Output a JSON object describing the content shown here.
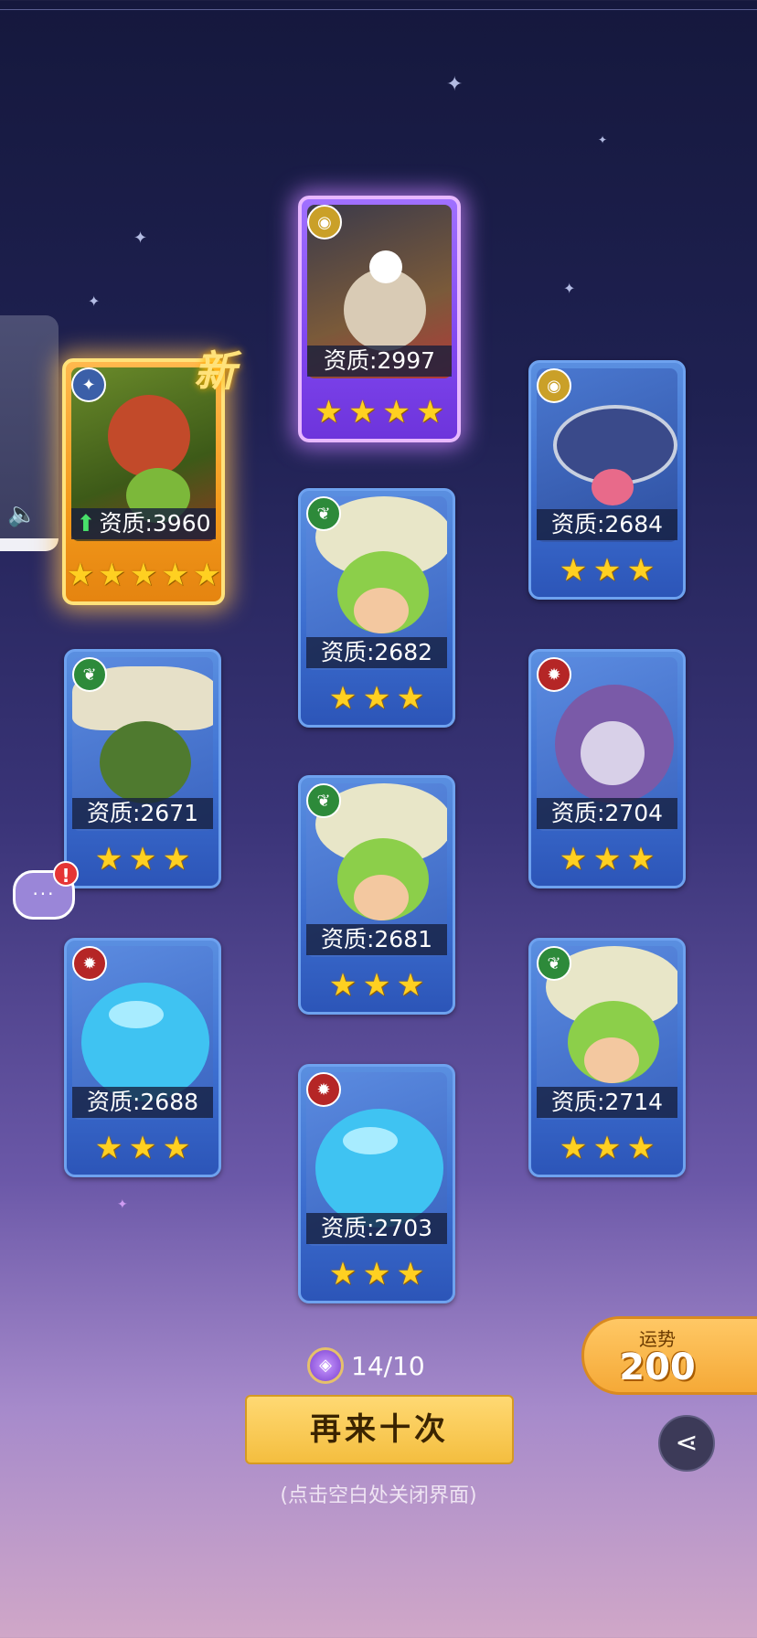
{
  "cards": [
    {
      "quality_label": "资质:3960",
      "stars": 5,
      "element": "water",
      "rarity": "gold",
      "is_new": true,
      "upgrade": true
    },
    {
      "quality_label": "资质:2997",
      "stars": 4,
      "element": "earth",
      "rarity": "purple",
      "is_new": false,
      "upgrade": false
    },
    {
      "quality_label": "资质:2684",
      "stars": 3,
      "element": "earth",
      "rarity": "blue",
      "is_new": false,
      "upgrade": false
    },
    {
      "quality_label": "资质:2682",
      "stars": 3,
      "element": "grass",
      "rarity": "blue",
      "is_new": false,
      "upgrade": false
    },
    {
      "quality_label": "资质:2671",
      "stars": 3,
      "element": "grass",
      "rarity": "blue",
      "is_new": false,
      "upgrade": false
    },
    {
      "quality_label": "资质:2704",
      "stars": 3,
      "element": "fire",
      "rarity": "blue",
      "is_new": false,
      "upgrade": false
    },
    {
      "quality_label": "资质:2681",
      "stars": 3,
      "element": "grass",
      "rarity": "blue",
      "is_new": false,
      "upgrade": false
    },
    {
      "quality_label": "资质:2688",
      "stars": 3,
      "element": "fire",
      "rarity": "blue",
      "is_new": false,
      "upgrade": false
    },
    {
      "quality_label": "资质:2714",
      "stars": 3,
      "element": "grass",
      "rarity": "blue",
      "is_new": false,
      "upgrade": false
    },
    {
      "quality_label": "资质:2703",
      "stars": 3,
      "element": "fire",
      "rarity": "blue",
      "is_new": false,
      "upgrade": false
    }
  ],
  "new_badge": "新",
  "counter": {
    "text": "14/10",
    "icon": "summon-token-icon"
  },
  "again_button": "再来十次",
  "hint": "(点击空白处关闭界面)",
  "fortune": {
    "label": "运势",
    "value": "200"
  },
  "share_icon": "share-icon",
  "chat_alert": "!"
}
